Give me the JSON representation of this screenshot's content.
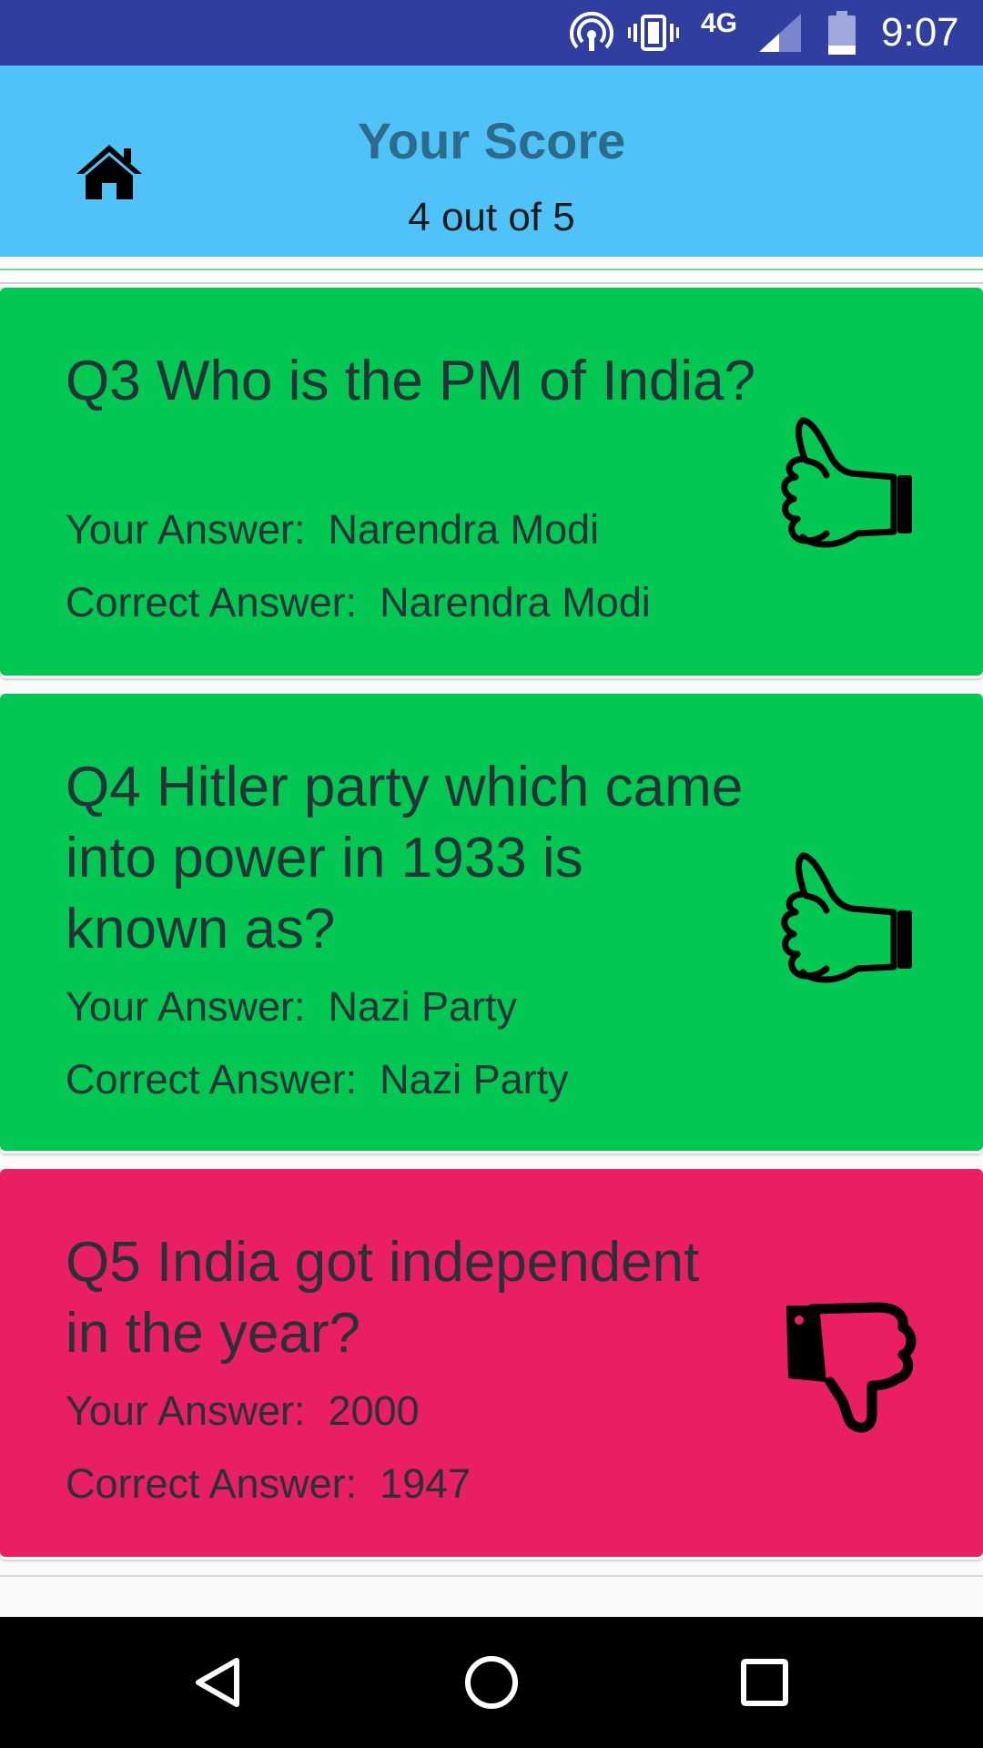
{
  "status_bar": {
    "network": "4G",
    "time": "9:07"
  },
  "header": {
    "title": "Your Score",
    "score_text": "4 out of 5"
  },
  "results": [
    {
      "question": "Q3  Who is the PM of India?",
      "your_answer": "Your Answer:  Narendra Modi",
      "correct_answer": "Correct Answer:  Narendra Modi",
      "status": "correct",
      "icon": "thumbs-up-icon"
    },
    {
      "question": "Q4  Hitler party which came into power in 1933 is known as?",
      "your_answer": "Your Answer:  Nazi Party",
      "correct_answer": "Correct Answer:  Nazi Party",
      "status": "correct",
      "icon": "thumbs-up-icon"
    },
    {
      "question": "Q5  India got independent in the year?",
      "your_answer": "Your Answer:  2000",
      "correct_answer": "Correct Answer:  1947",
      "status": "wrong",
      "icon": "thumbs-down-icon"
    }
  ],
  "colors": {
    "status_bar": "#303f9f",
    "header": "#4fc3f7",
    "title_text": "#2e6a8a",
    "correct": "#00c853",
    "wrong": "#e91e63",
    "nav_bar": "#000000"
  },
  "icons": {
    "home": "home-icon",
    "hotspot": "hotspot-icon",
    "vibrate": "vibrate-icon",
    "signal": "signal-icon",
    "battery": "battery-icon",
    "nav_back": "back-triangle-icon",
    "nav_home": "home-circle-icon",
    "nav_recents": "recents-square-icon"
  }
}
